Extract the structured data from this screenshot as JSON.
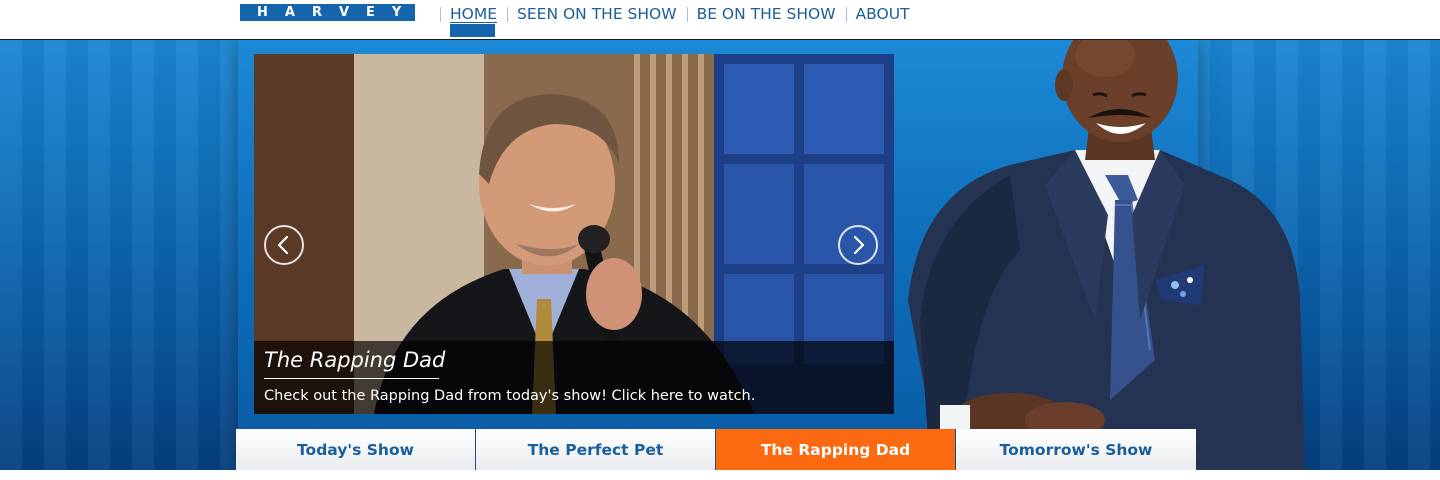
{
  "brand": {
    "logo_text": "HARVEY"
  },
  "nav": {
    "items": [
      {
        "label": "HOME",
        "active": true
      },
      {
        "label": "SEEN ON THE SHOW",
        "active": false
      },
      {
        "label": "BE ON THE SHOW",
        "active": false
      },
      {
        "label": "ABOUT",
        "active": false
      }
    ]
  },
  "slider": {
    "title": "The Rapping Dad",
    "description": "Check out the Rapping Dad from today's show! Click here to watch.",
    "prev_icon": "chevron-left-icon",
    "next_icon": "chevron-right-icon"
  },
  "tabs": [
    {
      "label": "Today's Show",
      "active": false
    },
    {
      "label": "The Perfect Pet",
      "active": false
    },
    {
      "label": "The Rapping Dad",
      "active": true
    },
    {
      "label": "Tomorrow's Show",
      "active": false
    }
  ],
  "colors": {
    "brand_blue": "#1565ad",
    "nav_text": "#1a5e9c",
    "hero_blue": "#0e6cb6",
    "active_tab": "#fb6a10"
  }
}
